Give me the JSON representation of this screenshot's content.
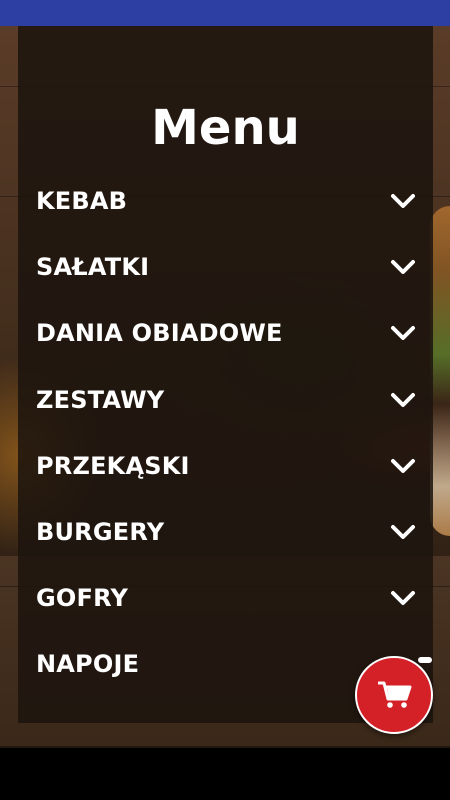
{
  "menu": {
    "title": "Menu",
    "items": [
      {
        "label": "KEBAB"
      },
      {
        "label": "SAŁATKI"
      },
      {
        "label": "DANIA OBIADOWE"
      },
      {
        "label": "ZESTAWY"
      },
      {
        "label": "PRZEKĄSKI"
      },
      {
        "label": "BURGERY"
      },
      {
        "label": "GOFRY"
      },
      {
        "label": "NAPOJE"
      }
    ],
    "expand_icon": "chevron-down-icon"
  },
  "cart_button": {
    "icon": "shopping-cart-icon",
    "color": "#d32127"
  },
  "colors": {
    "status_bar": "#2e3fa3",
    "panel": "#1c140e",
    "text": "#ffffff"
  }
}
